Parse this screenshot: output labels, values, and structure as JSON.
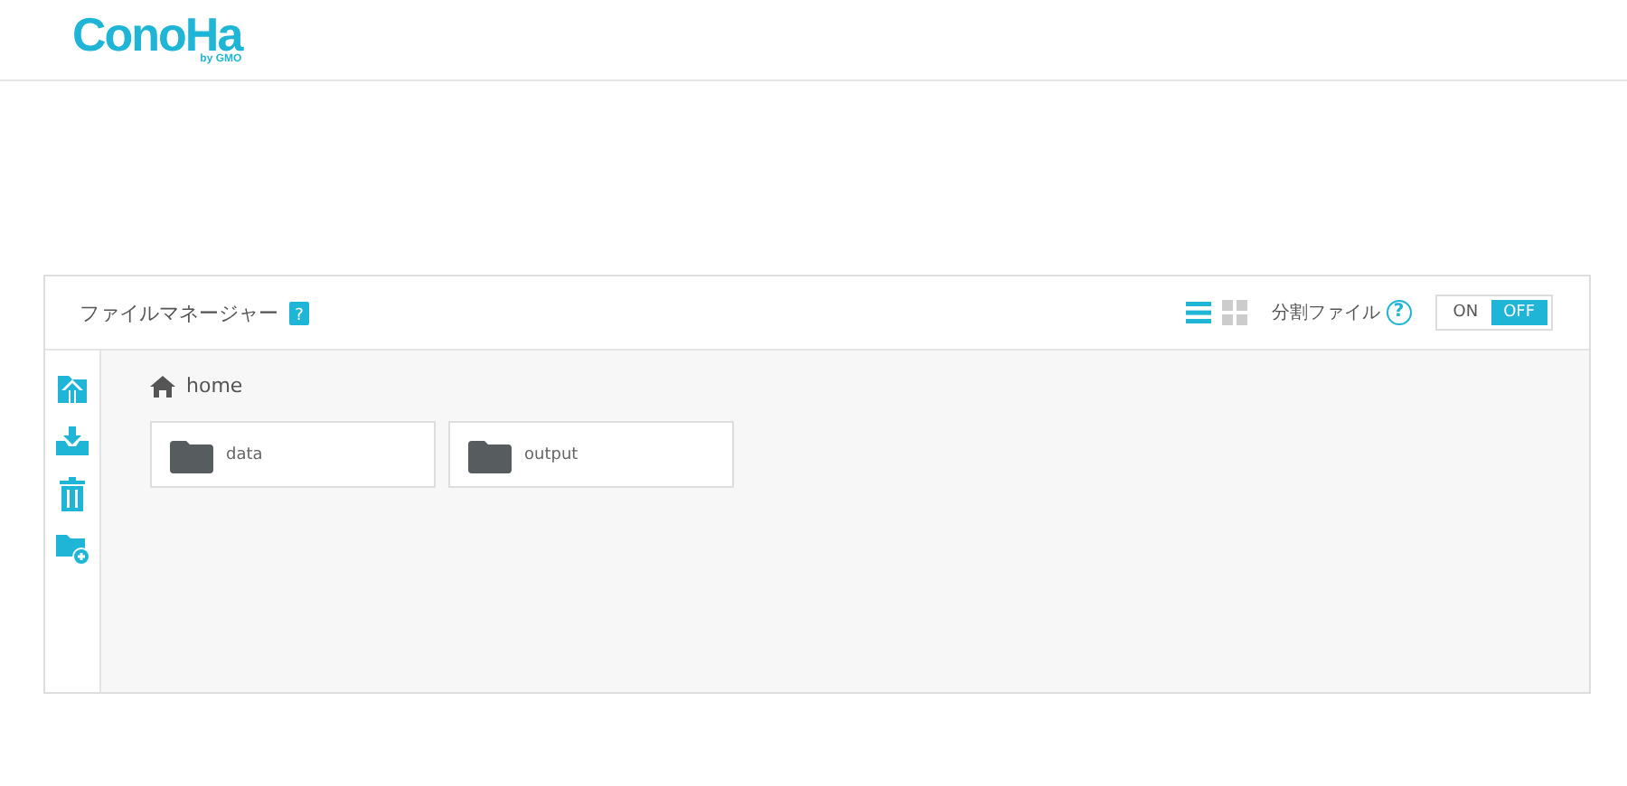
{
  "logo": {
    "name": "ConoHa",
    "byline": "by GMO"
  },
  "panel": {
    "title": "ファイルマネージャー",
    "view_modes": [
      {
        "kind": "list",
        "selected": true
      },
      {
        "kind": "grid",
        "selected": false
      }
    ],
    "split_file": {
      "label": "分割ファイル",
      "help": "?",
      "options": [
        {
          "label": "ON",
          "selected": false
        },
        {
          "label": "OFF",
          "selected": true
        }
      ]
    },
    "tools": [
      {
        "kind": "upload"
      },
      {
        "kind": "download"
      },
      {
        "kind": "delete"
      },
      {
        "kind": "new-folder"
      }
    ],
    "breadcrumb": "home",
    "folders": [
      {
        "name": "data"
      },
      {
        "name": "output"
      }
    ]
  }
}
